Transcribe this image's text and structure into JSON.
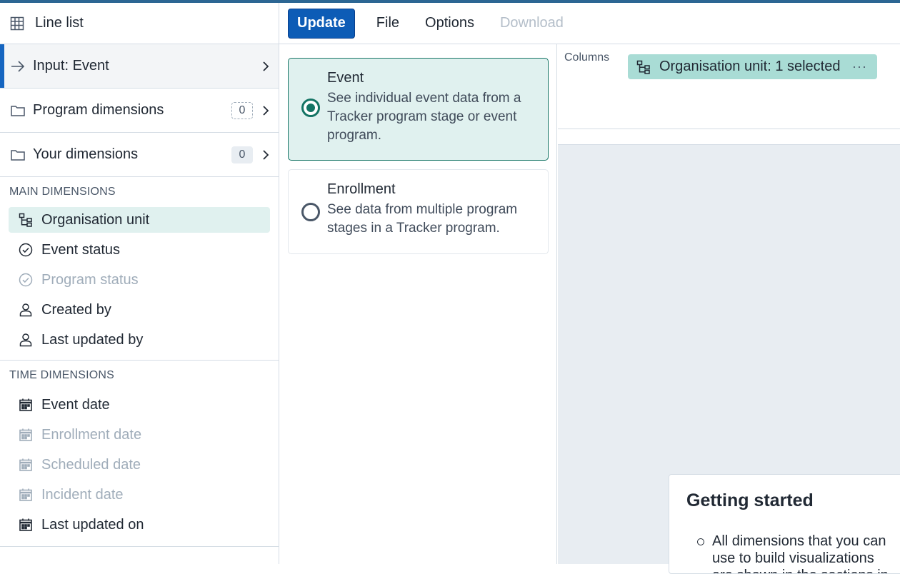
{
  "visualization_type": {
    "label": "Line list",
    "icon": "table-icon"
  },
  "sidebar": {
    "accordion": [
      {
        "label": "Input: Event",
        "icon": "arrow-right-icon",
        "active": true
      },
      {
        "label": "Program dimensions",
        "icon": "folder-icon",
        "count": "0"
      },
      {
        "label": "Your dimensions",
        "icon": "folder-icon",
        "count": "0"
      }
    ],
    "main_dimensions": {
      "title": "MAIN DIMENSIONS",
      "items": [
        {
          "label": "Organisation unit",
          "icon": "org-tree-icon",
          "selected": true
        },
        {
          "label": "Event status",
          "icon": "check-circle-icon"
        },
        {
          "label": "Program status",
          "icon": "check-circle-icon",
          "disabled": true
        },
        {
          "label": "Created by",
          "icon": "user-icon"
        },
        {
          "label": "Last updated by",
          "icon": "user-icon"
        }
      ]
    },
    "time_dimensions": {
      "title": "TIME DIMENSIONS",
      "items": [
        {
          "label": "Event date",
          "icon": "calendar-icon"
        },
        {
          "label": "Enrollment date",
          "icon": "calendar-icon",
          "disabled": true
        },
        {
          "label": "Scheduled date",
          "icon": "calendar-icon",
          "disabled": true
        },
        {
          "label": "Incident date",
          "icon": "calendar-icon",
          "disabled": true
        },
        {
          "label": "Last updated on",
          "icon": "calendar-icon"
        }
      ]
    }
  },
  "menubar": {
    "update": "Update",
    "file": "File",
    "options": "Options",
    "download": "Download"
  },
  "input_options": [
    {
      "title": "Event",
      "description": "See individual event data from a Tracker program stage or event program.",
      "selected": true
    },
    {
      "title": "Enrollment",
      "description": "See data from multiple program stages in a Tracker program.",
      "selected": false
    }
  ],
  "layout": {
    "columns_label": "Columns",
    "chip_label": "Organisation unit: 1 selected",
    "chip_more": "···"
  },
  "getting_started": {
    "title": "Getting started",
    "bullet": "All dimensions that you can use to build visualizations are shown in the sections in the left sidebar"
  },
  "colors": {
    "primary": "#0d5cb6",
    "teal": "#147464",
    "selected_bg": "#e0f1ef",
    "chip_bg": "#a9dcd5",
    "canvas_bg": "#e8edf2"
  }
}
